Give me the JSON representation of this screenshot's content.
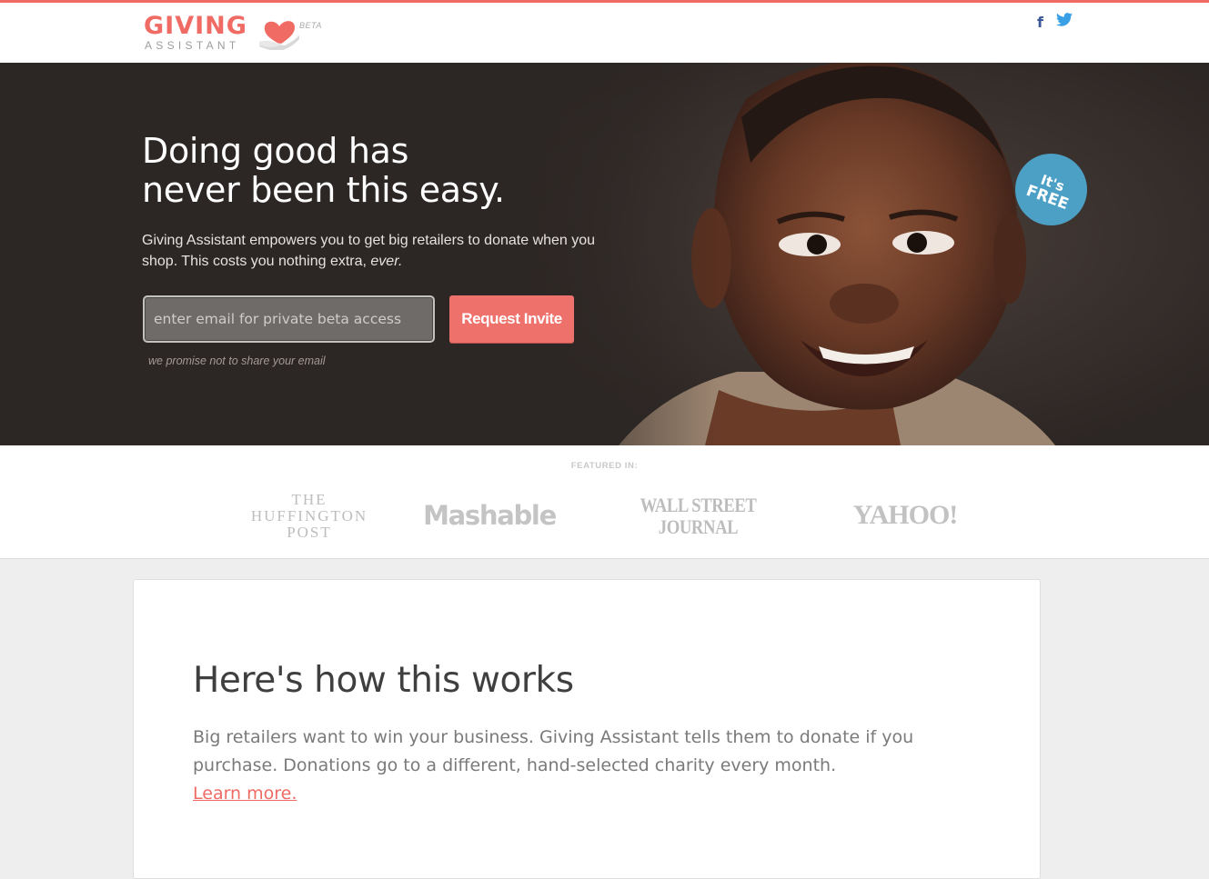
{
  "colors": {
    "accent": "#ef6b64",
    "badge": "#4da0c5",
    "hero_bg": "#2c2624"
  },
  "header": {
    "logo_word1": "GIVING",
    "logo_word2": "ASSISTANT",
    "logo_badge": "BETA",
    "social": [
      "facebook-icon",
      "twitter-icon"
    ]
  },
  "hero": {
    "headline_line1": "Doing good has",
    "headline_line2": "never been this easy.",
    "lead": "Giving Assistant empowers you to get big retailers to donate when you shop. This costs you nothing extra,",
    "lead_emphasis": "ever.",
    "email_placeholder": "enter email for private beta access",
    "email_value": "",
    "button_label": "Request Invite",
    "promise": "we promise not to share your email",
    "badge_line1": "It's",
    "badge_line2": "FREE"
  },
  "featured": {
    "label": "FEATURED IN:",
    "outlets": {
      "huffington_1": "THE",
      "huffington_2": "HUFFINGTON",
      "huffington_3": "POST",
      "mashable": "Mashable",
      "wsj_1": "WALL STREET",
      "wsj_2": "JOURNAL",
      "yahoo": "YAHOO!"
    }
  },
  "how": {
    "title": "Here's how this works",
    "body": "Big retailers want to win your business. Giving Assistant tells them to donate if you purchase. Donations go to a different, hand-selected charity every month.",
    "link": "Learn more."
  }
}
